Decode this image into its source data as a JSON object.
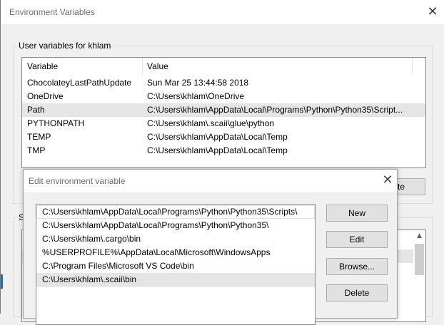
{
  "window": {
    "title": "Environment Variables",
    "close_glyph": "✕"
  },
  "user_vars": {
    "group_label": "User variables for khlam",
    "columns": [
      "Variable",
      "Value"
    ],
    "rows": [
      {
        "variable": "ChocolateyLastPathUpdate",
        "value": "Sun Mar 25 13:44:58 2018"
      },
      {
        "variable": "OneDrive",
        "value": "C:\\Users\\khlam\\OneDrive"
      },
      {
        "variable": "Path",
        "value": "C:\\Users\\khlam\\AppData\\Local\\Programs\\Python\\Python35\\Script..."
      },
      {
        "variable": "PYTHONPATH",
        "value": "C:\\Users\\khlam\\.scaii\\glue\\python"
      },
      {
        "variable": "TEMP",
        "value": "C:\\Users\\khlam\\AppData\\Local\\Temp"
      },
      {
        "variable": "TMP",
        "value": "C:\\Users\\khlam\\AppData\\Local\\Temp"
      }
    ],
    "selected_index": 2,
    "partial_button_label": "te"
  },
  "system_vars": {
    "group_label_partial": "S"
  },
  "dialog": {
    "title": "Edit environment variable",
    "close_glyph": "✕",
    "paths": [
      "C:\\Users\\khlam\\AppData\\Local\\Programs\\Python\\Python35\\Scripts\\",
      "C:\\Users\\khlam\\AppData\\Local\\Programs\\Python\\Python35\\",
      "C:\\Users\\khlam\\.cargo\\bin",
      "%USERPROFILE%\\AppData\\Local\\Microsoft\\WindowsApps",
      "C:\\Program Files\\Microsoft VS Code\\bin",
      "C:\\Users\\khlam\\.scaii\\bin"
    ],
    "selected_index": 5,
    "buttons": {
      "new": "New",
      "edit": "Edit",
      "browse": "Browse...",
      "delete": "Delete"
    }
  },
  "scrollbar": {
    "up_arrow": "▲"
  }
}
